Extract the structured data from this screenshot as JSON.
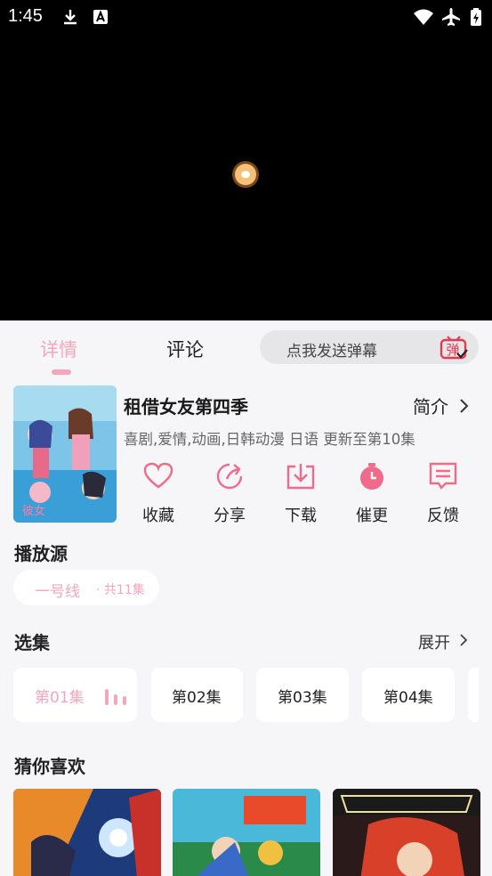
{
  "status_bar": {
    "time": "1:45"
  },
  "tabs": {
    "details": "详情",
    "comments": "评论"
  },
  "danmaku": {
    "placeholder": "点我发送弹幕",
    "icon_char": "弹"
  },
  "show": {
    "title": "租借女友第四季",
    "intro_label": "简介",
    "meta": "喜剧,爱情,动画,日韩动漫 日语 更新至第10集"
  },
  "actions": [
    {
      "label": "收藏",
      "icon": "heart-icon"
    },
    {
      "label": "分享",
      "icon": "share-icon"
    },
    {
      "label": "下载",
      "icon": "download-icon"
    },
    {
      "label": "催更",
      "icon": "timer-icon"
    },
    {
      "label": "反馈",
      "icon": "feedback-icon"
    }
  ],
  "source": {
    "title": "播放源",
    "name": "一号线",
    "count": "· 共11集"
  },
  "episodes": {
    "title": "选集",
    "expand_label": "展开",
    "items": [
      "第01集",
      "第02集",
      "第03集",
      "第04集"
    ]
  },
  "recommendations": {
    "title": "猜你喜欢"
  },
  "colors": {
    "accent": "#f6a6bb",
    "danmaku_icon": "#e8384f",
    "background": "#f6f6f8"
  }
}
